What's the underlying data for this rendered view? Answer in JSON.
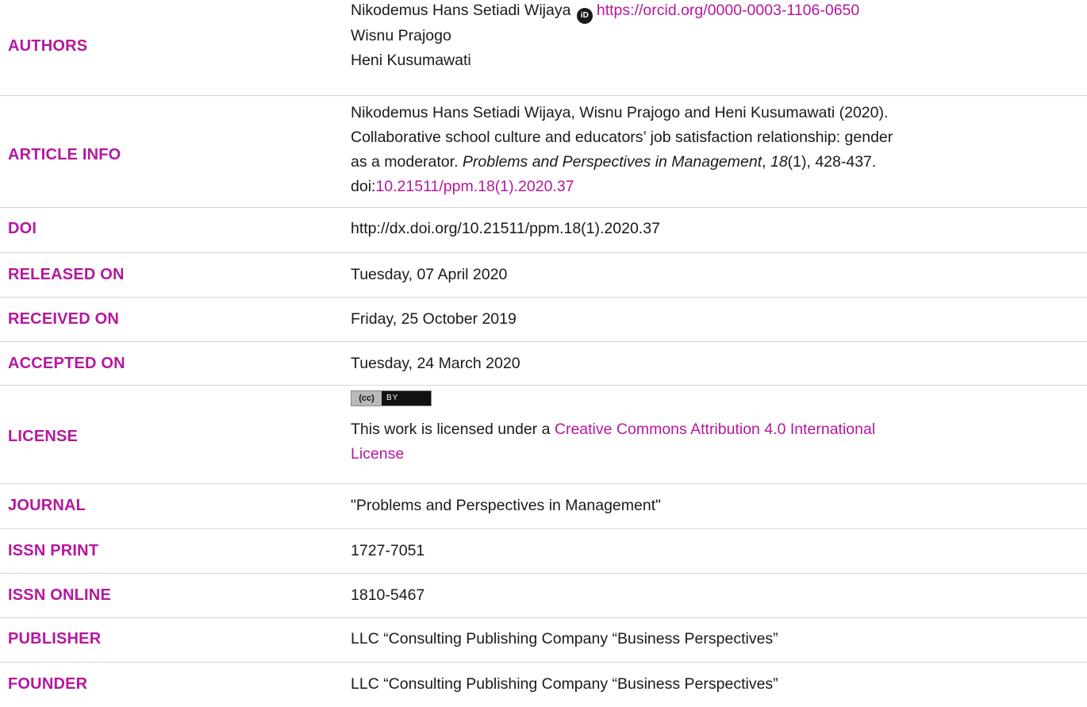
{
  "authors": {
    "label": "AUTHORS",
    "names": [
      "Nikodemus Hans Setiadi Wijaya",
      "Wisnu Prajogo",
      "Heni Kusumawati"
    ],
    "orcid_icon_text": "iD",
    "orcid_url": "https://orcid.org/0000-0003-1106-0650"
  },
  "article_info": {
    "label": "ARTICLE INFO",
    "lines": [
      "Nikodemus Hans Setiadi Wijaya, Wisnu Prajogo and Heni Kusumawati (2020).",
      "Collaborative school culture and educators’ job satisfaction relationship: gender",
      "as a moderator."
    ],
    "journal": "Problems and Perspectives in Management",
    "sep1": ",",
    "volume": "18",
    "issue_pages": "(1), 428-437.",
    "doi_prefix": "doi:",
    "doi_link": "10.21511/ppm.18(1).2020.37"
  },
  "doi": {
    "label": "DOI",
    "value": "http://dx.doi.org/10.21511/ppm.18(1).2020.37"
  },
  "released_on": {
    "label": "RELEASED ON",
    "value": "Tuesday, 07 April 2020"
  },
  "received_on": {
    "label": "RECEIVED ON",
    "value": "Friday, 25 October 2019"
  },
  "accepted_on": {
    "label": "ACCEPTED ON",
    "value": "Tuesday, 24 March 2020"
  },
  "license": {
    "label": "LICENSE",
    "badge_cc": "(cc)",
    "badge_by": "BY",
    "text": "This work is licensed under a ",
    "link_line1": "Creative Commons Attribution 4.0 International",
    "link_line2": "License"
  },
  "journal": {
    "label": "JOURNAL",
    "value": "\"Problems and Perspectives in Management\""
  },
  "issn_print": {
    "label": "ISSN PRINT",
    "value": "1727-7051"
  },
  "issn_online": {
    "label": "ISSN ONLINE",
    "value": "1810-5467"
  },
  "publisher": {
    "label": "PUBLISHER",
    "value": "LLC “Consulting Publishing Company “Business Perspectives”"
  },
  "founder": {
    "label": "FOUNDER",
    "value": "LLC “Consulting Publishing Company “Business Perspectives”"
  },
  "colors": {
    "label_magenta": "#b5179e",
    "text": "#1a1a1a",
    "divider": "#d6d6d6"
  }
}
